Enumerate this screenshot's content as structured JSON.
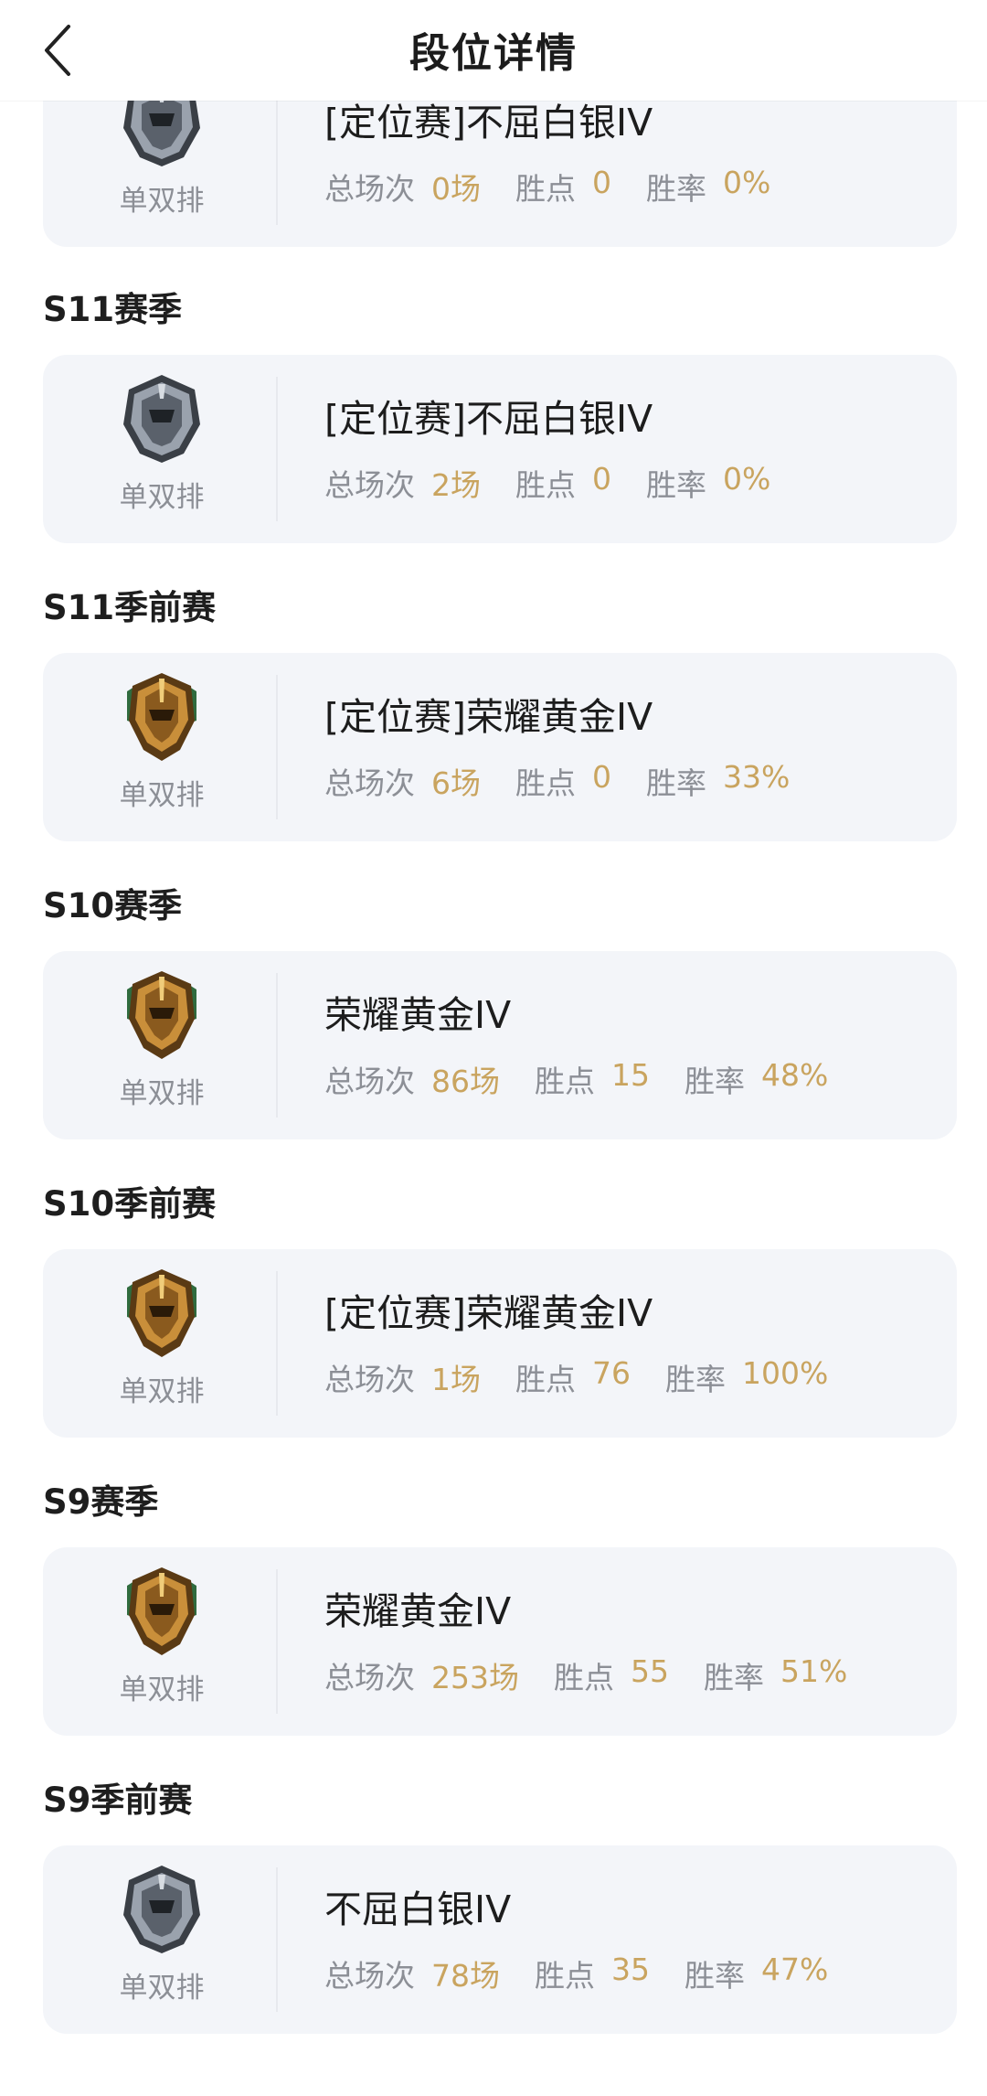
{
  "header": {
    "title": "段位详情"
  },
  "icons": {
    "back": "chevron-left-icon",
    "silver_emblem": "silver-rank-emblem-icon",
    "gold_emblem": "gold-rank-emblem-icon"
  },
  "colors": {
    "value_gold": "#c9a45f",
    "label_gray": "#8c8f96",
    "card_bg": "#f3f5f9"
  },
  "stat_labels": {
    "games": "总场次",
    "points": "胜点",
    "winrate": "胜率"
  },
  "entries": [
    {
      "season": "",
      "queue": "单双排",
      "tier": "silver",
      "rank": "[定位赛]不屈白银IV",
      "games": "0场",
      "points": "0",
      "winrate": "0%"
    },
    {
      "season": "S11赛季",
      "queue": "单双排",
      "tier": "silver",
      "rank": "[定位赛]不屈白银IV",
      "games": "2场",
      "points": "0",
      "winrate": "0%"
    },
    {
      "season": "S11季前赛",
      "queue": "单双排",
      "tier": "gold",
      "rank": "[定位赛]荣耀黄金IV",
      "games": "6场",
      "points": "0",
      "winrate": "33%"
    },
    {
      "season": "S10赛季",
      "queue": "单双排",
      "tier": "gold",
      "rank": "荣耀黄金IV",
      "games": "86场",
      "points": "15",
      "winrate": "48%"
    },
    {
      "season": "S10季前赛",
      "queue": "单双排",
      "tier": "gold",
      "rank": "[定位赛]荣耀黄金IV",
      "games": "1场",
      "points": "76",
      "winrate": "100%"
    },
    {
      "season": "S9赛季",
      "queue": "单双排",
      "tier": "gold",
      "rank": "荣耀黄金IV",
      "games": "253场",
      "points": "55",
      "winrate": "51%"
    },
    {
      "season": "S9季前赛",
      "queue": "单双排",
      "tier": "silver",
      "rank": "不屈白银IV",
      "games": "78场",
      "points": "35",
      "winrate": "47%"
    }
  ]
}
